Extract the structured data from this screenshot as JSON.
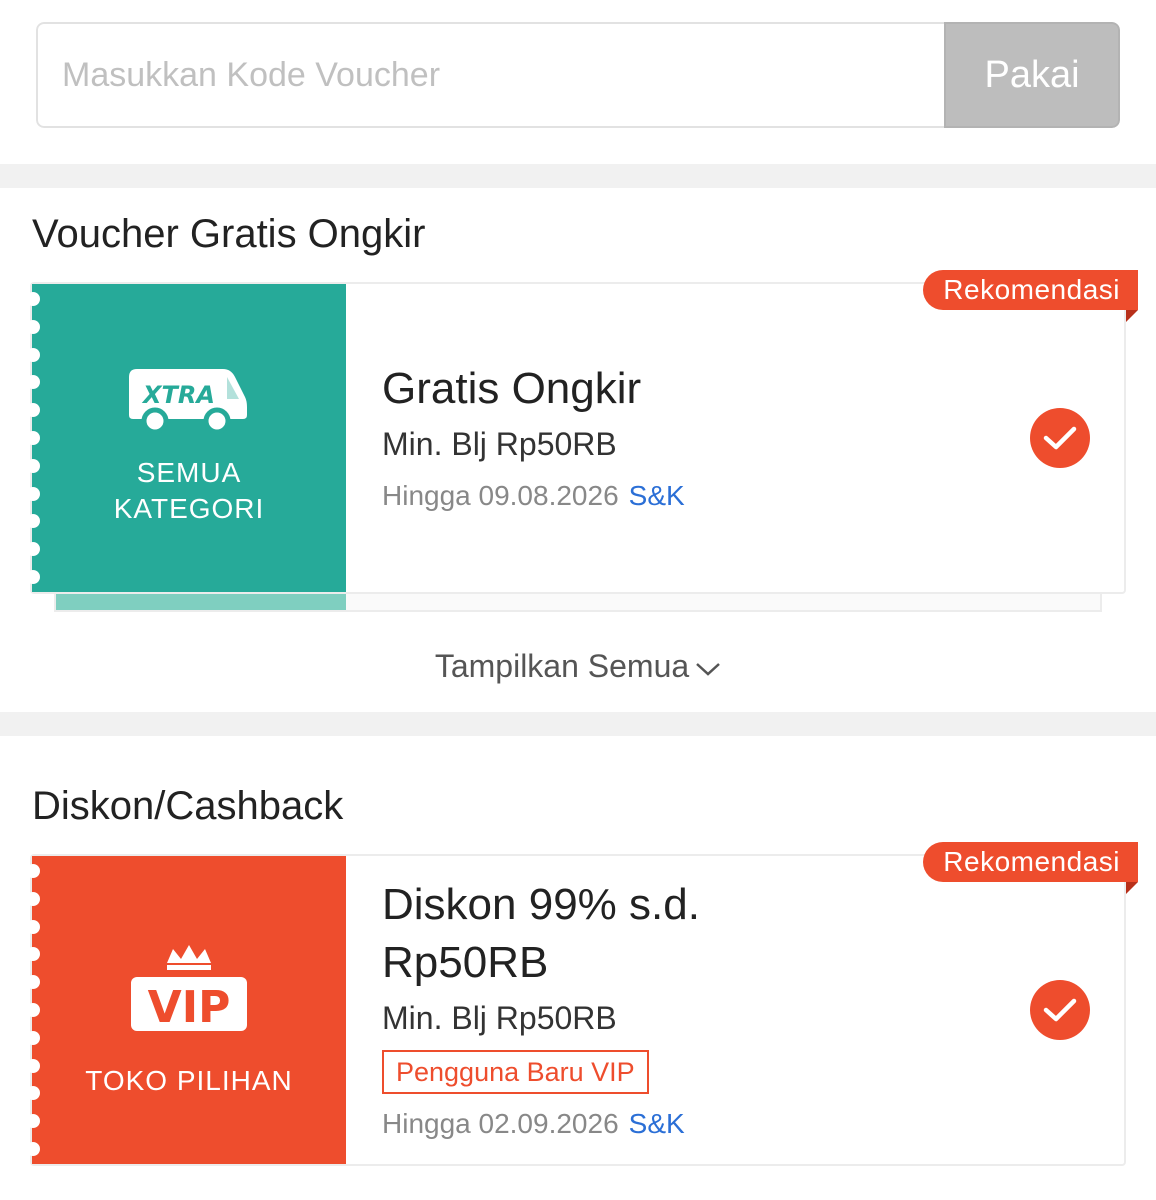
{
  "voucher_code": {
    "placeholder": "Masukkan Kode Voucher",
    "value": "",
    "apply_label": "Pakai"
  },
  "sections": {
    "shipping": {
      "title": "Voucher Gratis Ongkir",
      "show_all_label": "Tampilkan Semua",
      "voucher": {
        "logo_text": "XTRA",
        "stub_label_line1": "SEMUA",
        "stub_label_line2": "KATEGORI",
        "title": "Gratis Ongkir",
        "min_spend": "Min. Blj Rp50RB",
        "expiry": "Hingga 09.08.2026",
        "terms": "S&K",
        "ribbon": "Rekomendasi",
        "selected": true,
        "stub_color": "#26aa99"
      }
    },
    "discount": {
      "title": "Diskon/Cashback",
      "voucher": {
        "logo_text": "VIP",
        "stub_label": "TOKO PILIHAN",
        "title_line1": "Diskon 99% s.d.",
        "title_line2": "Rp50RB",
        "min_spend": "Min. Blj Rp50RB",
        "badge": "Pengguna Baru VIP",
        "expiry": "Hingga 02.09.2026",
        "terms": "S&K",
        "ribbon": "Rekomendasi",
        "selected": true,
        "stub_color": "#ee4d2d"
      }
    }
  },
  "colors": {
    "accent": "#ee4d2d",
    "teal": "#26aa99",
    "link": "#2b6fd6",
    "apply_button_disabled": "#bdbdbd"
  }
}
